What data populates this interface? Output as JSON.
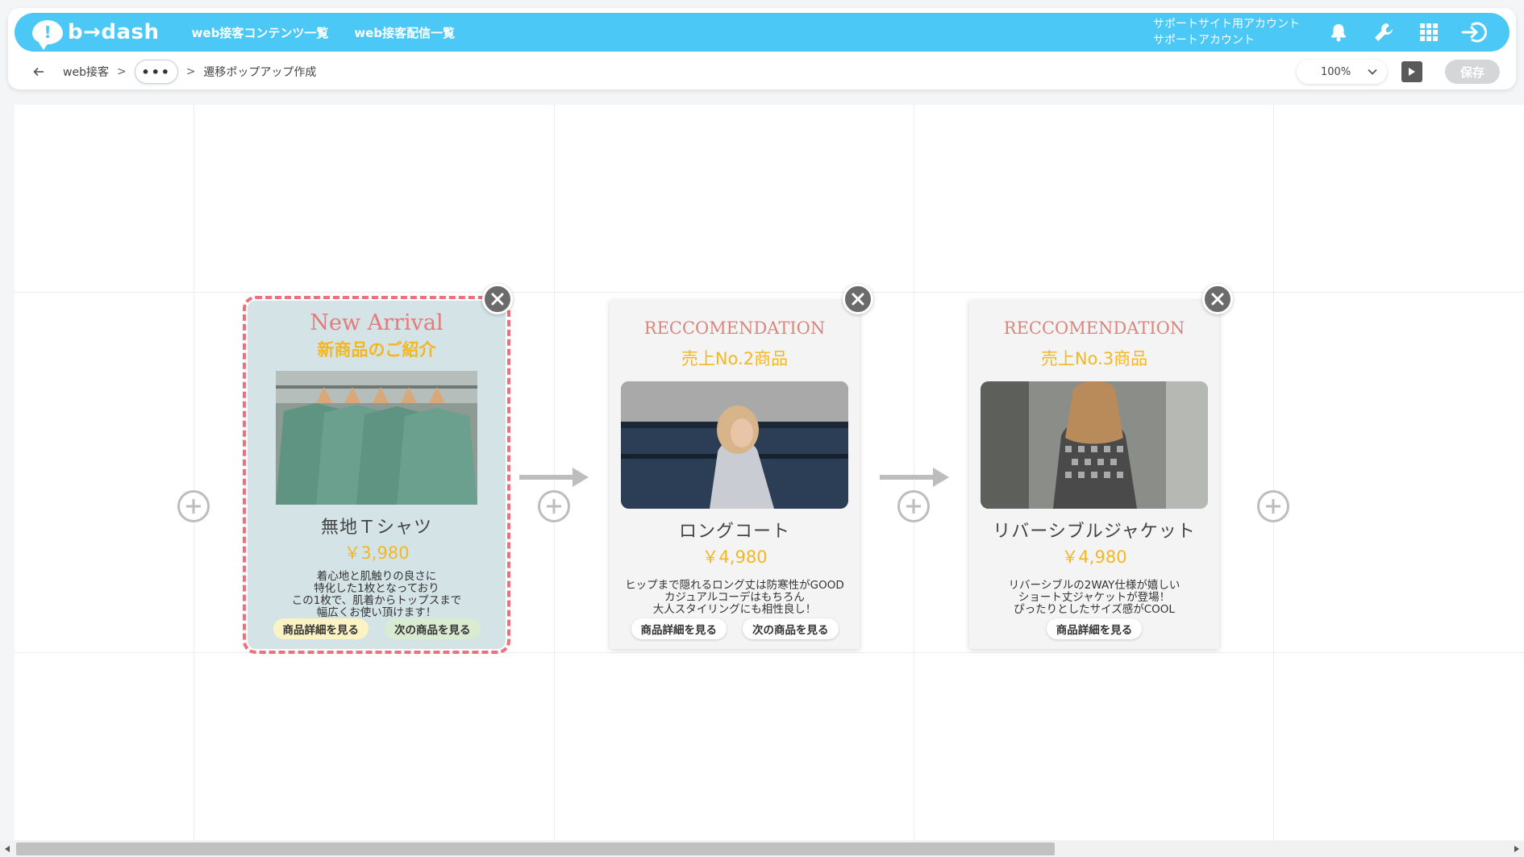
{
  "header": {
    "logo_text": "b→dash",
    "nav": [
      {
        "label": "web接客コンテンツ一覧"
      },
      {
        "label": "web接客配信一覧"
      }
    ],
    "account_line1": "サポートサイト用アカウント",
    "account_line2": "サポートアカウント",
    "icons": [
      "bell-icon",
      "wrench-icon",
      "grid-icon",
      "logout-icon"
    ]
  },
  "subbar": {
    "breadcrumb_root": "web接客",
    "separator": ">",
    "ellipsis": "•••",
    "current": "遷移ポップアップ作成",
    "zoom_value": "100%",
    "save_label": "保存"
  },
  "cards": [
    {
      "heading": "New Arrival",
      "subheading": "新商品のご紹介",
      "product_name": "無地Ｔシャツ",
      "price": "￥3,980",
      "description": "着心地と肌触りの良さに\n特化した1枚となっており\nこの1枚で、肌着からトップスまで\n幅広くお使い頂けます！",
      "buttons": [
        "商品詳細を見る",
        "次の商品を見る"
      ]
    },
    {
      "heading": "RECCOMENDATION",
      "subheading": "売上No.2商品",
      "product_name": "ロングコート",
      "price": "￥4,980",
      "description": "ヒップまで隠れるロング丈は防寒性がGOOD\nカジュアルコーデはもちろん\n大人スタイリングにも相性良し！",
      "buttons": [
        "商品詳細を見る",
        "次の商品を見る"
      ]
    },
    {
      "heading": "RECCOMENDATION",
      "subheading": "売上No.3商品",
      "product_name": "リバーシブルジャケット",
      "price": "￥4,980",
      "description": "リバーシブルの2WAY仕様が嬉しい\nショート丈ジャケットが登場！\nぴったりとしたサイズ感がCOOL",
      "buttons": [
        "商品詳細を見る"
      ]
    }
  ],
  "colors": {
    "topbar": "#4bc8f5",
    "selected_outline": "#ef6f7c",
    "price": "#f3b724",
    "heading": "#e57a7a"
  }
}
